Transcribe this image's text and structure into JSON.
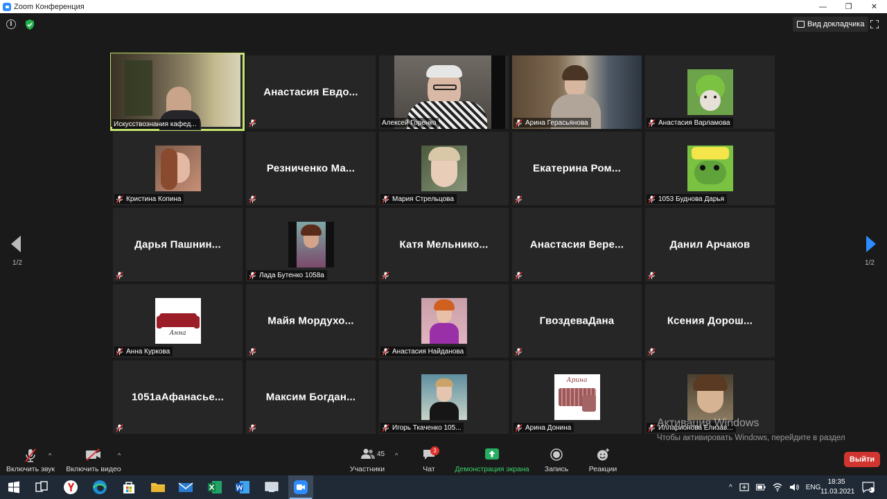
{
  "window": {
    "title": "Zoom Конференция",
    "minimize": "—",
    "maximize": "❐",
    "close": "✕"
  },
  "top": {
    "info": "i",
    "speaker_view": "Вид докладчика"
  },
  "pagination": {
    "left": "1/2",
    "right": "1/2"
  },
  "tiles": [
    {
      "label": "Искусствознания кафед..."
    },
    {
      "name": "Анастасия Евдо..."
    },
    {
      "label": "Алексей Горенко"
    },
    {
      "label": "Арина Герасьянова"
    },
    {
      "label": "Анастасия Варламова"
    },
    {
      "label": "Кристина Копина"
    },
    {
      "name": "Резниченко Ма..."
    },
    {
      "label": "Мария Стрельцова"
    },
    {
      "name": "Екатерина Ром..."
    },
    {
      "label": "1053 Буднова Дарья"
    },
    {
      "name": "Дарья Пашнин..."
    },
    {
      "label": "Лада Бутенко 1058а"
    },
    {
      "name": "Катя Мельнико..."
    },
    {
      "name": "Анастасия Вере..."
    },
    {
      "name": "Данил Арчаков"
    },
    {
      "label": "Анна Куркова",
      "avatar_text": "Анна"
    },
    {
      "name": "Майя Мордухо..."
    },
    {
      "label": "Анастасия Найданова"
    },
    {
      "name": "ГвоздеваДана"
    },
    {
      "name": "Ксения Дорош..."
    },
    {
      "name": "1051аАфанасье..."
    },
    {
      "name": "Максим Богдан..."
    },
    {
      "label": "Игорь Ткаченко 105..."
    },
    {
      "label": "Арина Донина",
      "avatar_text": "Арина"
    },
    {
      "label": "Илларионова Елизав..."
    }
  ],
  "watermark": {
    "title": "Активация Windows",
    "text": "Чтобы активировать Windows, перейдите в раздел \"Параметры\"."
  },
  "toolbar": {
    "audio": "Включить звук",
    "video": "Включить видео",
    "participants": "Участники",
    "participants_count": "45",
    "chat": "Чат",
    "chat_badge": "3",
    "share": "Демонстрация экрана",
    "record": "Запись",
    "reactions": "Реакции",
    "leave": "Выйти",
    "caret": "^"
  },
  "taskbar": {
    "lang": "ENG",
    "time": "18:35",
    "date": "11.03.2021",
    "notif": "1"
  },
  "colors": {
    "active_border": "#c5e66f",
    "share_green": "#27ae60",
    "leave_red": "#d0352f",
    "mute_red": "#e03030"
  }
}
